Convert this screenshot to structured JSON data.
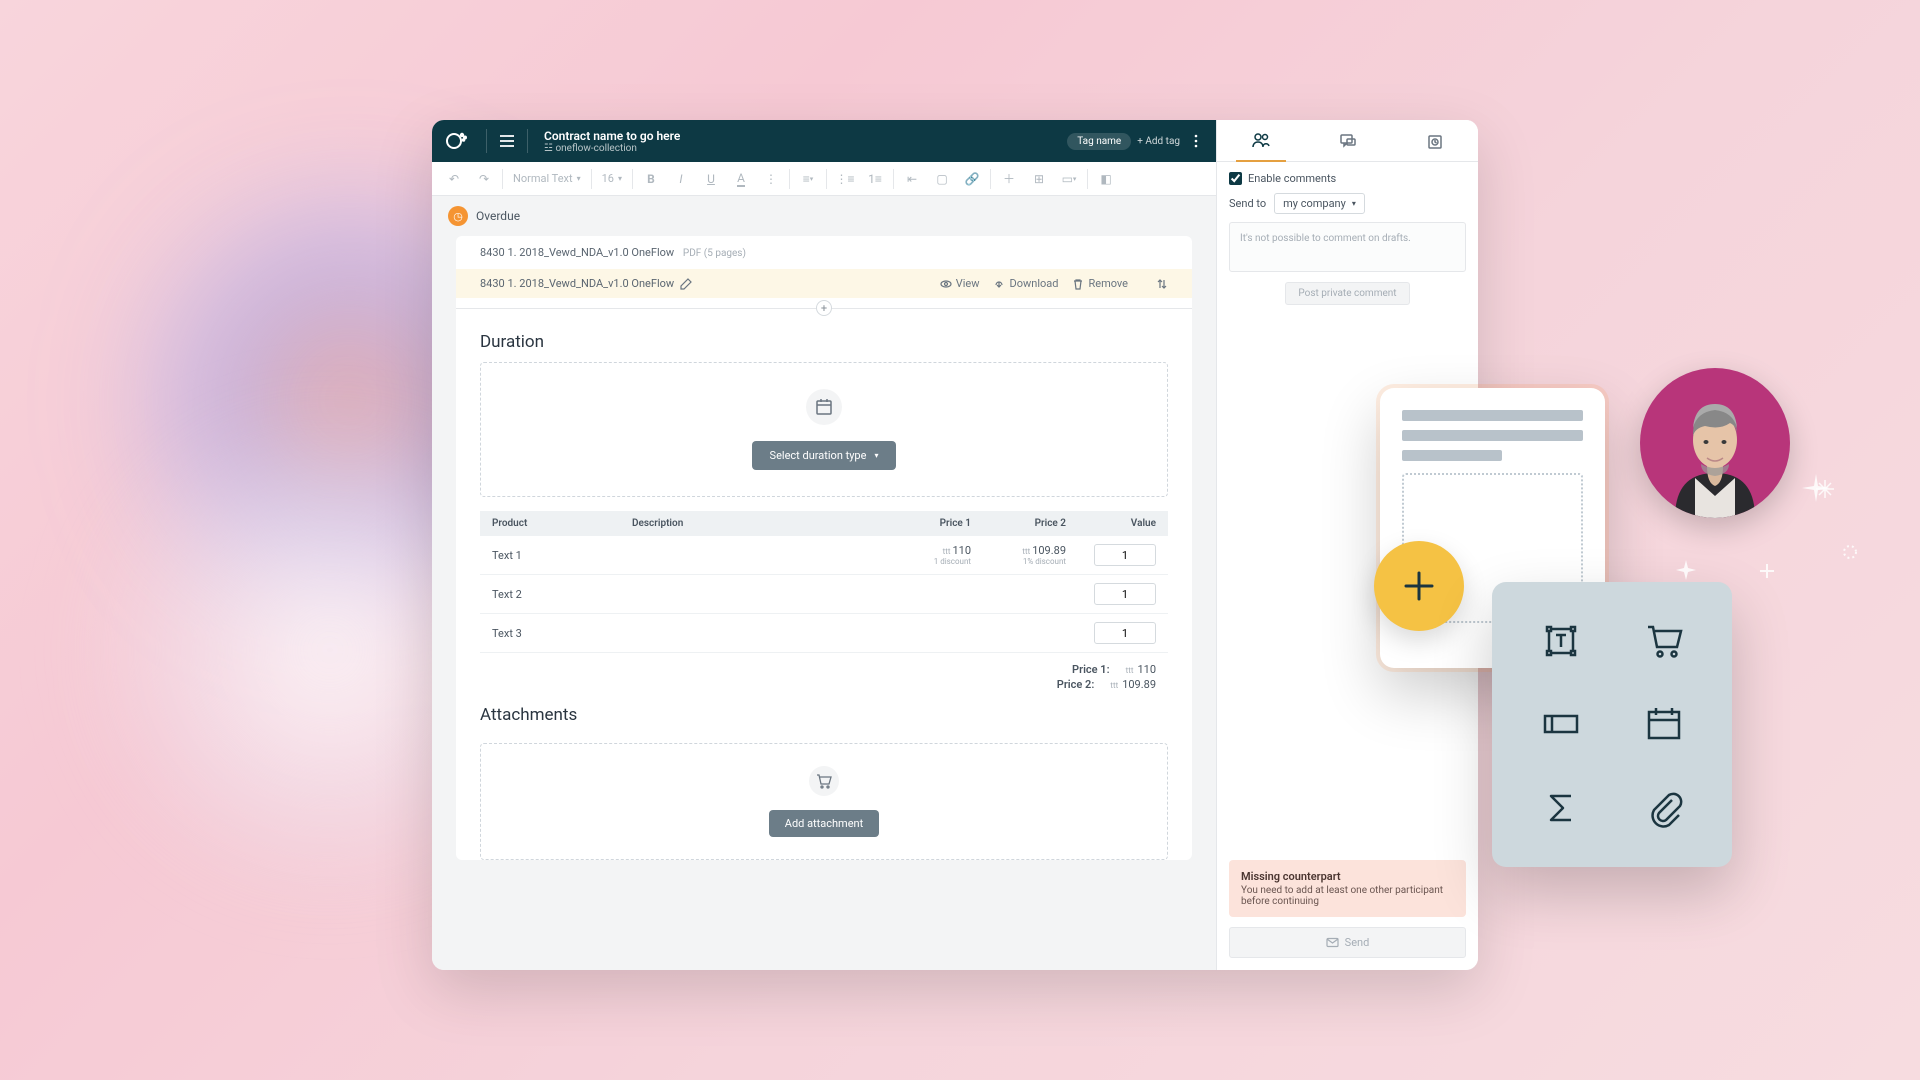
{
  "header": {
    "title": "Contract name to go here",
    "collection": "☳ oneflow-collection",
    "tag": "Tag name",
    "add_tag": "+ Add tag"
  },
  "toolbar": {
    "normal_text": "Normal Text",
    "font_size": "16"
  },
  "status": {
    "label": "Overdue"
  },
  "doc": {
    "title": "8430 1. 2018_Vewd_NDA_v1.0 OneFlow",
    "meta": "PDF (5 pages)",
    "file": "8430 1. 2018_Vewd_NDA_v1.0 OneFlow"
  },
  "file_actions": {
    "view": "View",
    "download": "Download",
    "remove": "Remove"
  },
  "sections": {
    "duration": "Duration",
    "attachments": "Attachments"
  },
  "duration": {
    "select_btn": "Select duration type"
  },
  "table": {
    "head": {
      "product": "Product",
      "desc": "Description",
      "price1": "Price 1",
      "price2": "Price 2",
      "value": "Value"
    },
    "rows": [
      {
        "product": "Text 1",
        "p1": "110",
        "p1disc": "1 discount",
        "p2": "109.89",
        "p2disc": "1% discount",
        "val": "1"
      },
      {
        "product": "Text 2",
        "val": "1"
      },
      {
        "product": "Text 3",
        "val": "1"
      }
    ],
    "currency": "ttt"
  },
  "totals": {
    "p1_label": "Price 1:",
    "p1": "110",
    "p2_label": "Price 2:",
    "p2": "109.89"
  },
  "attach": {
    "btn": "Add attachment"
  },
  "side": {
    "enable": "Enable comments",
    "sendto": "Send to",
    "company": "my company",
    "comment_placeholder": "It's not possible to comment on drafts.",
    "post": "Post private comment",
    "warning_title": "Missing counterpart",
    "warning_text": "You need to add at least one other participant before continuing",
    "send": "Send"
  }
}
